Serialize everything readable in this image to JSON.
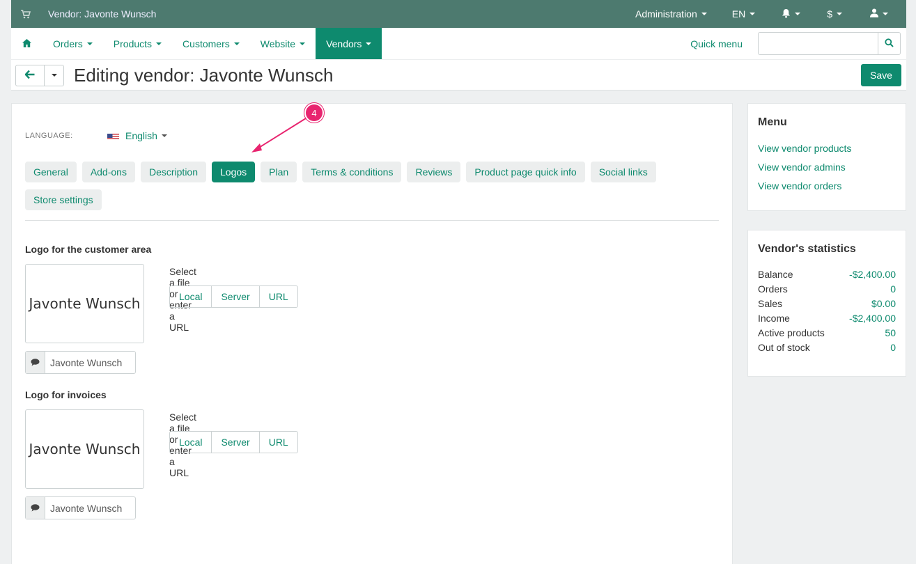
{
  "topbar": {
    "store_title": "Vendor: Javonte Wunsch",
    "administration": "Administration",
    "language": "EN",
    "currency": "$",
    "icons": [
      "cart-icon",
      "bell-icon",
      "user-icon"
    ]
  },
  "nav": {
    "items": [
      "Orders",
      "Products",
      "Customers",
      "Website",
      "Vendors"
    ],
    "active": "Vendors",
    "quick_menu": "Quick menu",
    "search_value": ""
  },
  "title": {
    "text": "Editing vendor: Javonte Wunsch",
    "save": "Save"
  },
  "language": {
    "label": "LANGUAGE:",
    "selected": "English"
  },
  "tabs": [
    "General",
    "Add-ons",
    "Description",
    "Logos",
    "Plan",
    "Terms & conditions",
    "Reviews",
    "Product page quick info",
    "Social links",
    "Store settings"
  ],
  "active_tab": "Logos",
  "annotation": {
    "number": "4"
  },
  "logos": [
    {
      "title": "Logo for the customer area",
      "preview_text": "Javonte Wunsch",
      "alt_text": "Javonte Wunsch",
      "select_text": "Select a file or enter a URL",
      "buttons": [
        "Local",
        "Server",
        "URL"
      ]
    },
    {
      "title": "Logo for invoices",
      "preview_text": "Javonte Wunsch",
      "alt_text": "Javonte Wunsch",
      "select_text": "Select a file or enter a URL",
      "buttons": [
        "Local",
        "Server",
        "URL"
      ]
    }
  ],
  "sidebar": {
    "menu_title": "Menu",
    "menu_links": [
      "View vendor products",
      "View vendor admins",
      "View vendor orders"
    ],
    "stats_title": "Vendor's statistics",
    "stats": [
      {
        "label": "Balance",
        "value": "-$2,400.00"
      },
      {
        "label": "Orders",
        "value": "0"
      },
      {
        "label": "Sales",
        "value": "$0.00"
      },
      {
        "label": "Income",
        "value": "-$2,400.00"
      },
      {
        "label": "Active products",
        "value": "50"
      },
      {
        "label": "Out of stock",
        "value": "0"
      }
    ]
  },
  "colors": {
    "topbar": "#4d7a6f",
    "accent": "#0e8a6e",
    "annotation": "#e8246f"
  }
}
